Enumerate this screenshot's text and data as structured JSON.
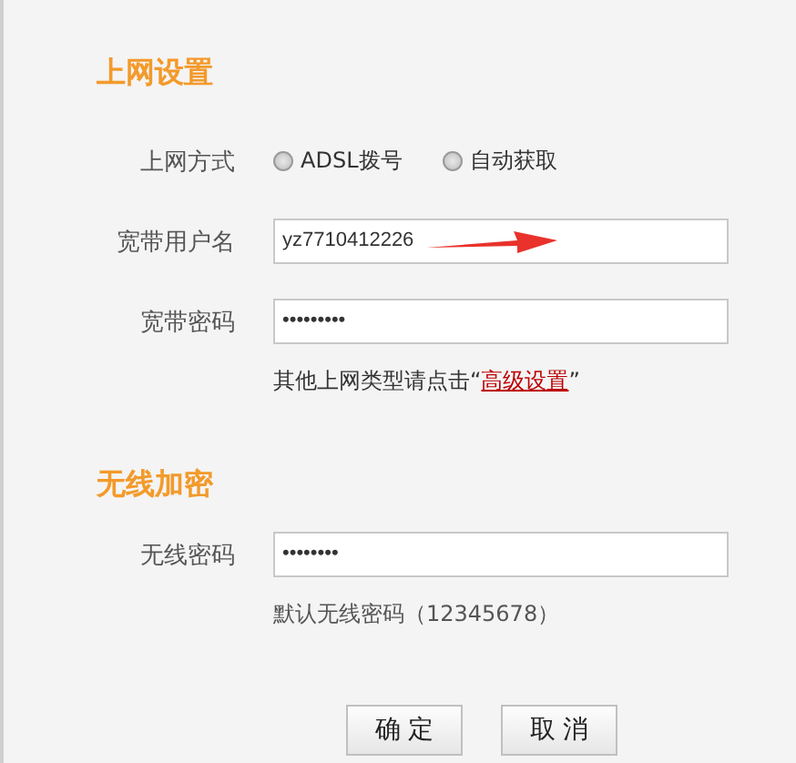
{
  "internet_section": {
    "title": "上网设置",
    "method": {
      "label": "上网方式",
      "options": [
        {
          "label": "ADSL拨号",
          "selected": false
        },
        {
          "label": "自动获取",
          "selected": false
        }
      ]
    },
    "username": {
      "label": "宽带用户名",
      "value": "yz7710412226"
    },
    "password": {
      "label": "宽带密码",
      "value": "•••••••••"
    },
    "advanced_hint": {
      "text_before": "其他上网类型请点击“",
      "link": "高级设置",
      "text_after": "”"
    }
  },
  "wireless_section": {
    "title": "无线加密",
    "password": {
      "label": "无线密码",
      "value": "••••••••"
    },
    "hint": "默认无线密码（12345678）"
  },
  "buttons": [
    {
      "label": "确 定"
    },
    {
      "label": "取 消"
    }
  ]
}
